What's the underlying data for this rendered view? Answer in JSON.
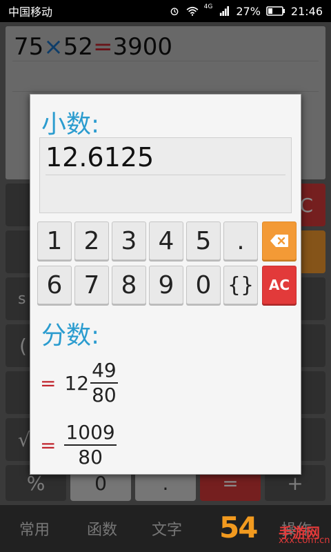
{
  "status_bar": {
    "carrier": "中国移动",
    "network": "4G",
    "battery": "27%",
    "time": "21:46",
    "icons": [
      "alarm-icon",
      "wifi-icon",
      "signal-icon",
      "battery-icon"
    ]
  },
  "calculator": {
    "expression": {
      "a": "75",
      "op": "×",
      "b": "52",
      "eq": "=",
      "result": "3900"
    },
    "bottom_tabs": [
      "常用",
      "函数",
      "文字",
      "",
      "操作"
    ],
    "visible_keys": [
      "%",
      "0",
      ".",
      "=",
      "+",
      "C",
      "s",
      "(",
      "√"
    ]
  },
  "dialog": {
    "decimal_title": "小数:",
    "decimal_value": "12.6125",
    "keypad_row1": [
      "1",
      "2",
      "3",
      "4",
      "5",
      "."
    ],
    "keypad_row2": [
      "6",
      "7",
      "8",
      "9",
      "0",
      "{}"
    ],
    "delete_key_icon": "backspace-icon",
    "ac_label": "AC",
    "fraction_title": "分数:",
    "mixed_fraction": {
      "eq": "=",
      "whole": "12",
      "numerator": "49",
      "denominator": "80"
    },
    "improper_fraction": {
      "eq": "=",
      "numerator": "1009",
      "denominator": "80"
    }
  },
  "watermark": {
    "logo_text": "54",
    "site_text": "手游网",
    "domain": "xxx.com.cn"
  },
  "colors": {
    "accent_blue": "#2b9ccf",
    "equals_red": "#c0232c",
    "delete_orange": "#f39a36",
    "ac_red": "#e23a3a"
  }
}
